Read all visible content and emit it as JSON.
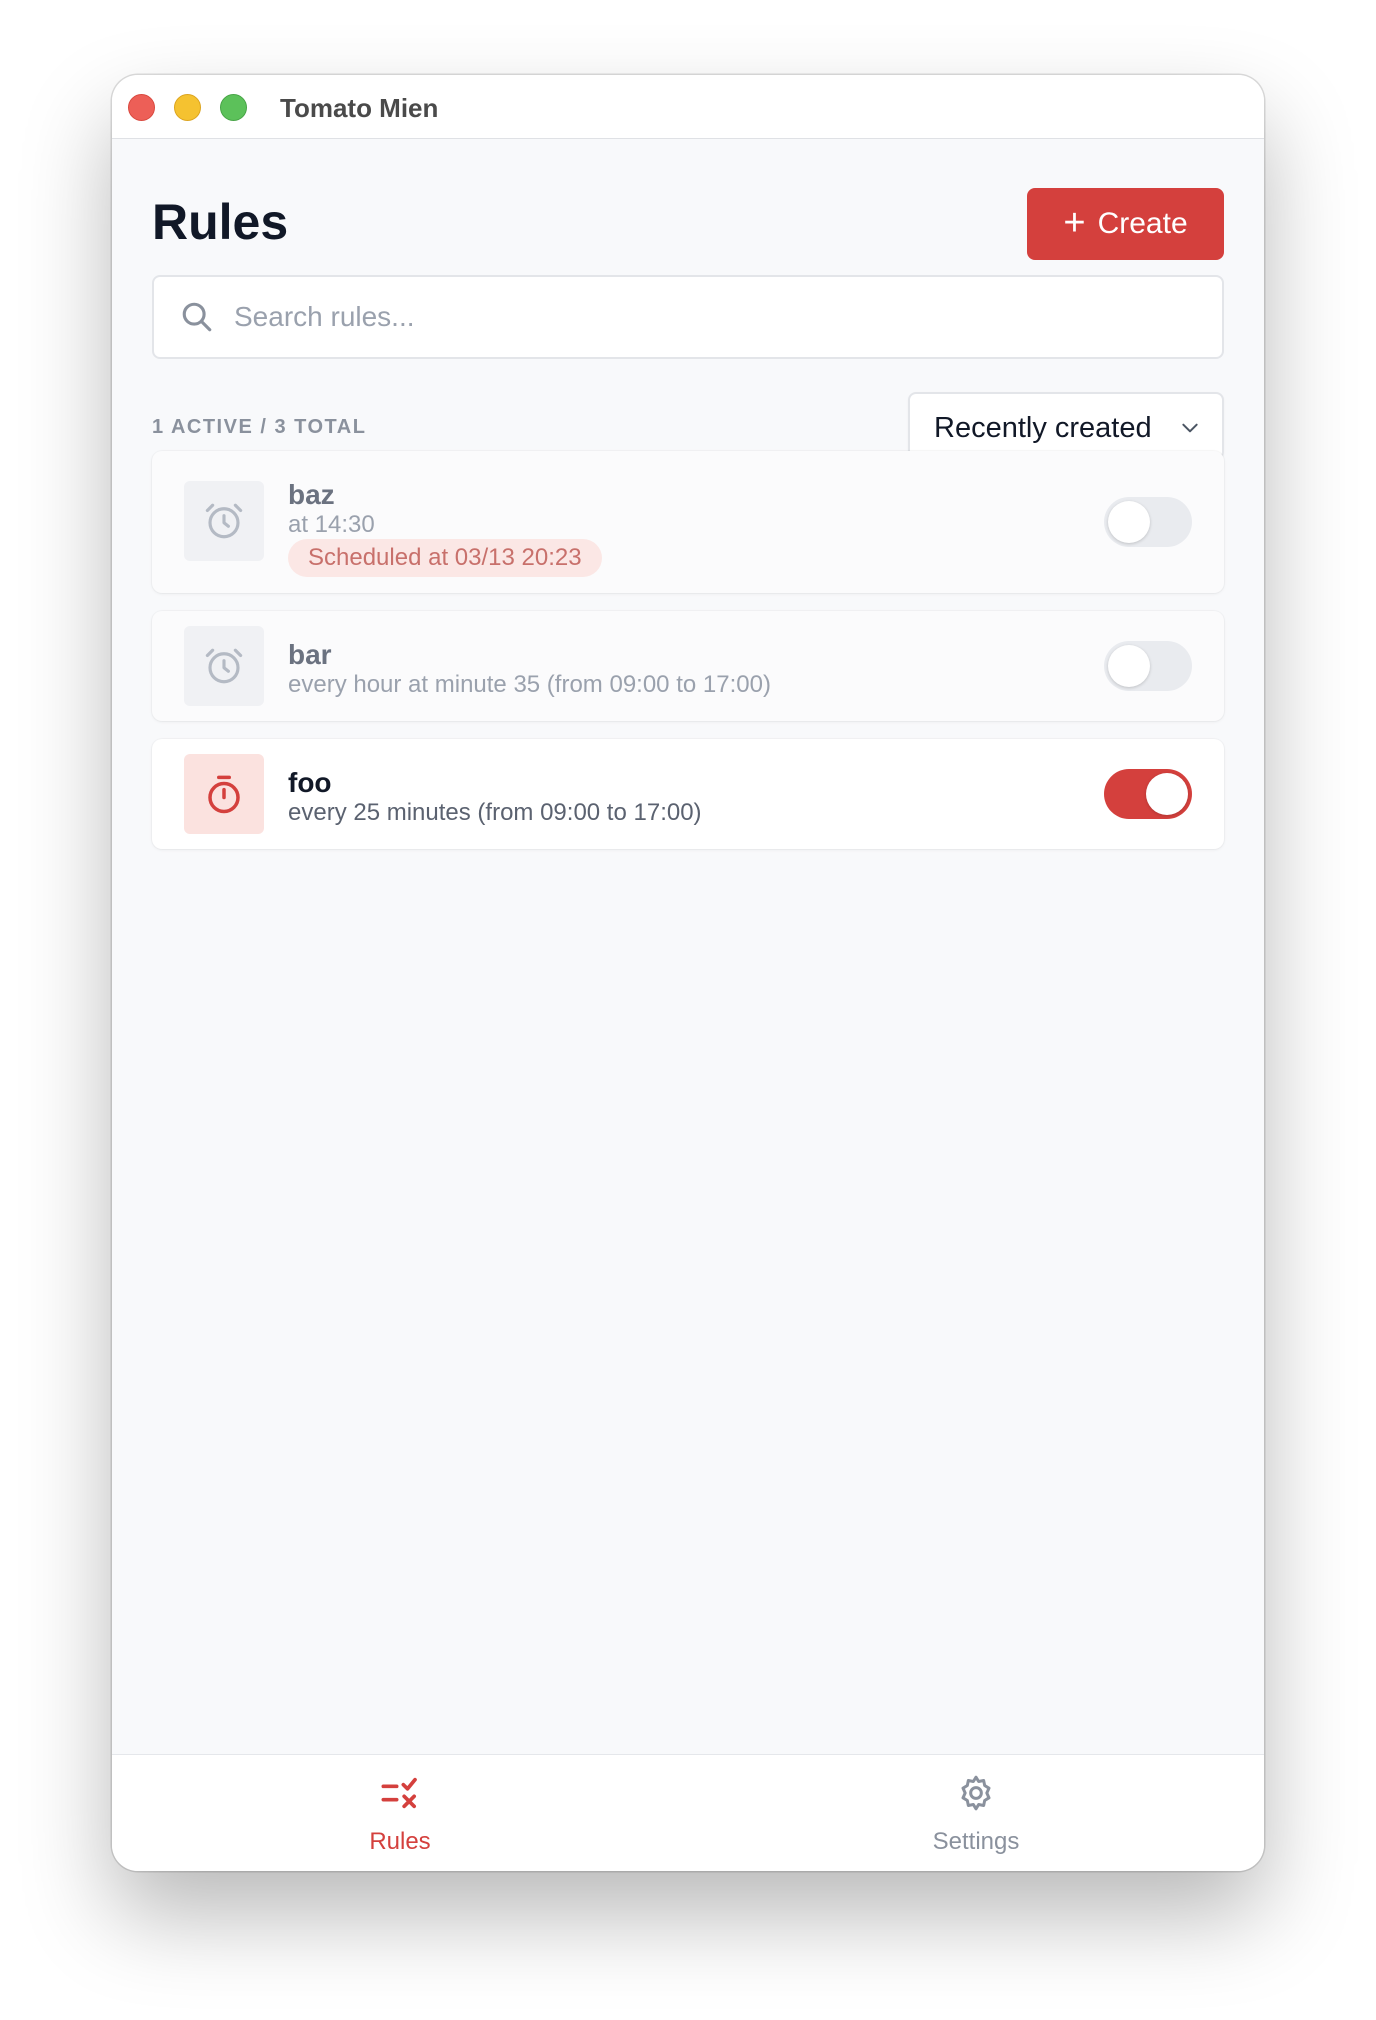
{
  "window": {
    "title": "Tomato Mien",
    "controls": [
      "close",
      "minimize",
      "maximize"
    ]
  },
  "header": {
    "title": "Rules",
    "create_button": {
      "label": "Create",
      "icon": "plus-icon"
    }
  },
  "search": {
    "placeholder": "Search rules...",
    "value": "",
    "icon": "search-icon"
  },
  "summary": {
    "text": "1 ACTIVE / 3 TOTAL"
  },
  "sort": {
    "selected": "Recently created",
    "icon": "chevron-down-icon"
  },
  "rules": [
    {
      "name": "baz",
      "description": "at 14:30",
      "badge": "Scheduled at 03/13 20:23",
      "icon": "alarm-clock-icon",
      "enabled": false
    },
    {
      "name": "bar",
      "description": "every hour at minute 35 (from 09:00 to 17:00)",
      "icon": "alarm-clock-icon",
      "enabled": false
    },
    {
      "name": "foo",
      "description": "every 25 minutes (from 09:00 to 17:00)",
      "icon": "stopwatch-icon",
      "enabled": true
    }
  ],
  "nav": {
    "items": [
      {
        "label": "Rules",
        "icon": "rules-list-icon",
        "active": true
      },
      {
        "label": "Settings",
        "icon": "gear-icon",
        "active": false
      }
    ]
  },
  "colors": {
    "accent": "#d4403d",
    "accent_light": "#fbe2df",
    "text_primary": "#111827",
    "text_muted": "#9aa1ad",
    "background": "#f8f9fb"
  }
}
